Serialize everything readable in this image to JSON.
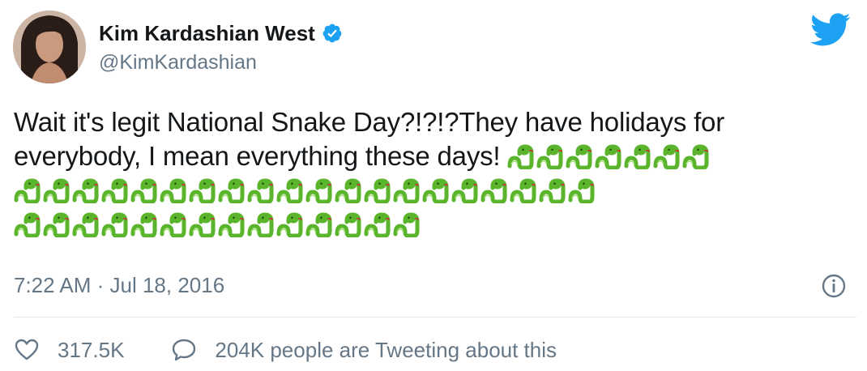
{
  "tweet": {
    "author_name": "Kim Kardashian West",
    "author_handle": "@KimKardashian",
    "text_line1": "Wait it's legit National Snake Day?!?!?They have holidays for",
    "text_line2": "everybody, I mean everything these days!",
    "snake_emoji_count_line2": 7,
    "snake_emoji_count_line3": 20,
    "snake_emoji_count_line4": 14,
    "timestamp": "7:22 AM · Jul 18, 2016",
    "likes_count": "317.5K",
    "talking_text": "204K people are Tweeting about this"
  },
  "icons": {
    "verified": "verified-badge-icon",
    "platform": "twitter-bird-icon",
    "info": "info-icon",
    "like": "heart-icon",
    "reply": "speech-bubble-icon",
    "emoji": "snake-emoji"
  },
  "colors": {
    "twitter_blue": "#1da1f2",
    "secondary_text": "#657786",
    "primary_text": "#14171a",
    "snake_green": "#5ab52c"
  }
}
